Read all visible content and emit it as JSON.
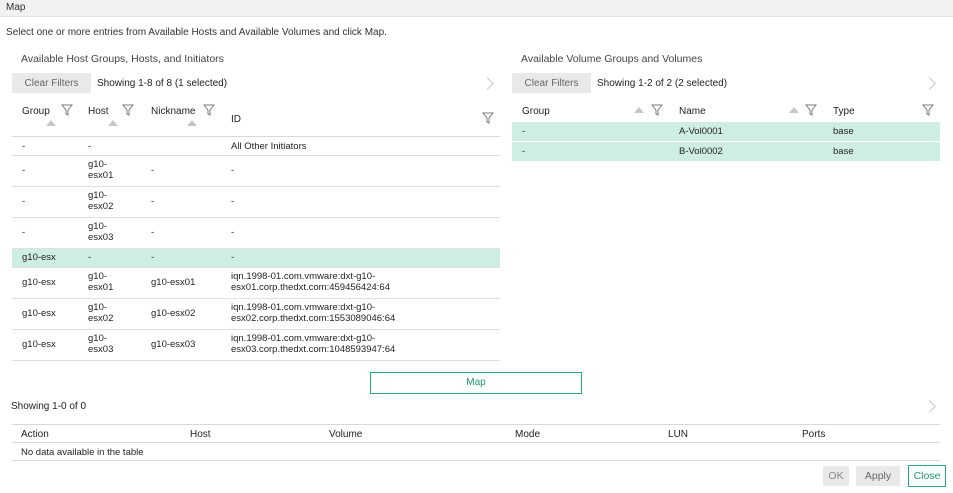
{
  "window": {
    "title": "Map"
  },
  "instructions": "Select one or more entries from Available Hosts and Available Volumes and click Map.",
  "hosts_section": {
    "title": "Available Host Groups, Hosts, and Initiators",
    "clear_filters": "Clear Filters",
    "showing": "Showing 1-8 of 8 (1 selected)",
    "columns": [
      "Group",
      "Host",
      "Nickname",
      "ID"
    ],
    "rows": [
      {
        "group": "-",
        "host": "-",
        "nickname": "",
        "id": "All Other Initiators",
        "selected": false
      },
      {
        "group": "-",
        "host": "g10-\nesx01",
        "nickname": "-",
        "id": "-",
        "selected": false
      },
      {
        "group": "-",
        "host": "g10-\nesx02",
        "nickname": "-",
        "id": "-",
        "selected": false
      },
      {
        "group": "-",
        "host": "g10-\nesx03",
        "nickname": "-",
        "id": "-",
        "selected": false
      },
      {
        "group": "g10-esx",
        "host": "-",
        "nickname": "-",
        "id": "-",
        "selected": true
      },
      {
        "group": "g10-esx",
        "host": "g10-\nesx01",
        "nickname": "g10-esx01",
        "id": "iqn.1998-01.com.vmware:dxt-g10-\nesx01.corp.thedxt.com:459456424:64",
        "selected": false
      },
      {
        "group": "g10-esx",
        "host": "g10-\nesx02",
        "nickname": "g10-esx02",
        "id": "iqn.1998-01.com.vmware:dxt-g10-\nesx02.corp.thedxt.com:1553089046:64",
        "selected": false
      },
      {
        "group": "g10-esx",
        "host": "g10-\nesx03",
        "nickname": "g10-esx03",
        "id": "iqn.1998-01.com.vmware:dxt-g10-\nesx03.corp.thedxt.com:1048593947:64",
        "selected": false
      }
    ]
  },
  "volumes_section": {
    "title": "Available Volume Groups and Volumes",
    "clear_filters": "Clear Filters",
    "showing": "Showing 1-2 of 2 (2 selected)",
    "columns": [
      "Group",
      "Name",
      "Type"
    ],
    "rows": [
      {
        "group": "-",
        "name": "A-Vol0001",
        "type": "base",
        "selected": true
      },
      {
        "group": "-",
        "name": "B-Vol0002",
        "type": "base",
        "selected": true
      }
    ]
  },
  "map_button": "Map",
  "mappings": {
    "showing": "Showing 1-0 of 0",
    "columns": [
      "Action",
      "Host",
      "Volume",
      "Mode",
      "LUN",
      "Ports"
    ],
    "empty": "No data available in the table"
  },
  "footer": {
    "ok": "OK",
    "apply": "Apply",
    "close": "Close"
  },
  "colors": {
    "accent": "#29a776",
    "selected_row": "#cfeee2"
  }
}
